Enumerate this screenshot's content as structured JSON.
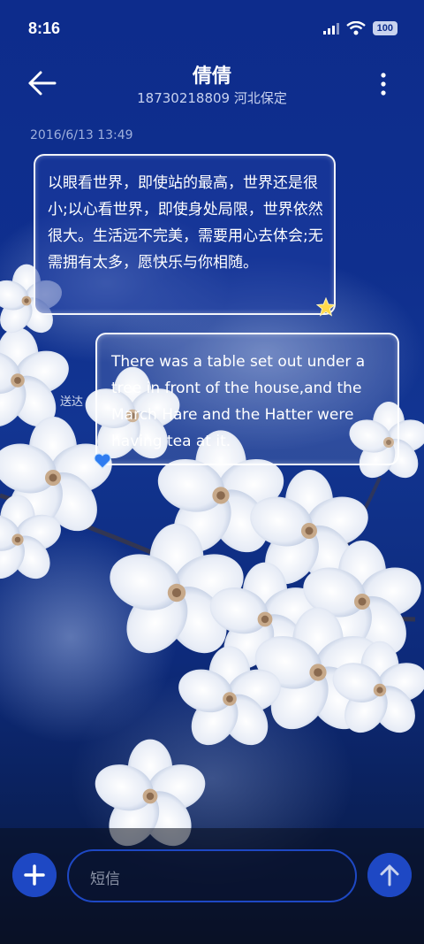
{
  "status_bar": {
    "time": "8:16",
    "battery": "100",
    "icons": [
      "signal-icon",
      "wifi-icon",
      "battery-icon"
    ]
  },
  "header": {
    "back_icon": "arrow-left-icon",
    "title": "倩倩",
    "subtitle": "18730218809 河北保定",
    "menu_icon": "more-vertical-icon"
  },
  "conversation": {
    "timestamp": "2016/6/13 13:49",
    "messages": [
      {
        "direction": "incoming",
        "text": "以眼看世界，即使站的最高，世界还是很小;以心看世界，即使身处局限，世界依然很大。生活远不完美，需要用心去体会;无需拥有太多，愿快乐与你相随。",
        "decoration_icon": "star-icon"
      },
      {
        "direction": "outgoing",
        "text": "There was a table set out under a tree in front of the house,and the March Hare and the Hatter were having tea at it.",
        "status": "送达",
        "decoration_icon": "heart-icon"
      }
    ]
  },
  "composer": {
    "placeholder": "短信",
    "add_icon": "plus-icon",
    "send_icon": "arrow-up-icon"
  },
  "colors": {
    "accent": "#1e48c4",
    "background": "#0d2c8c"
  }
}
